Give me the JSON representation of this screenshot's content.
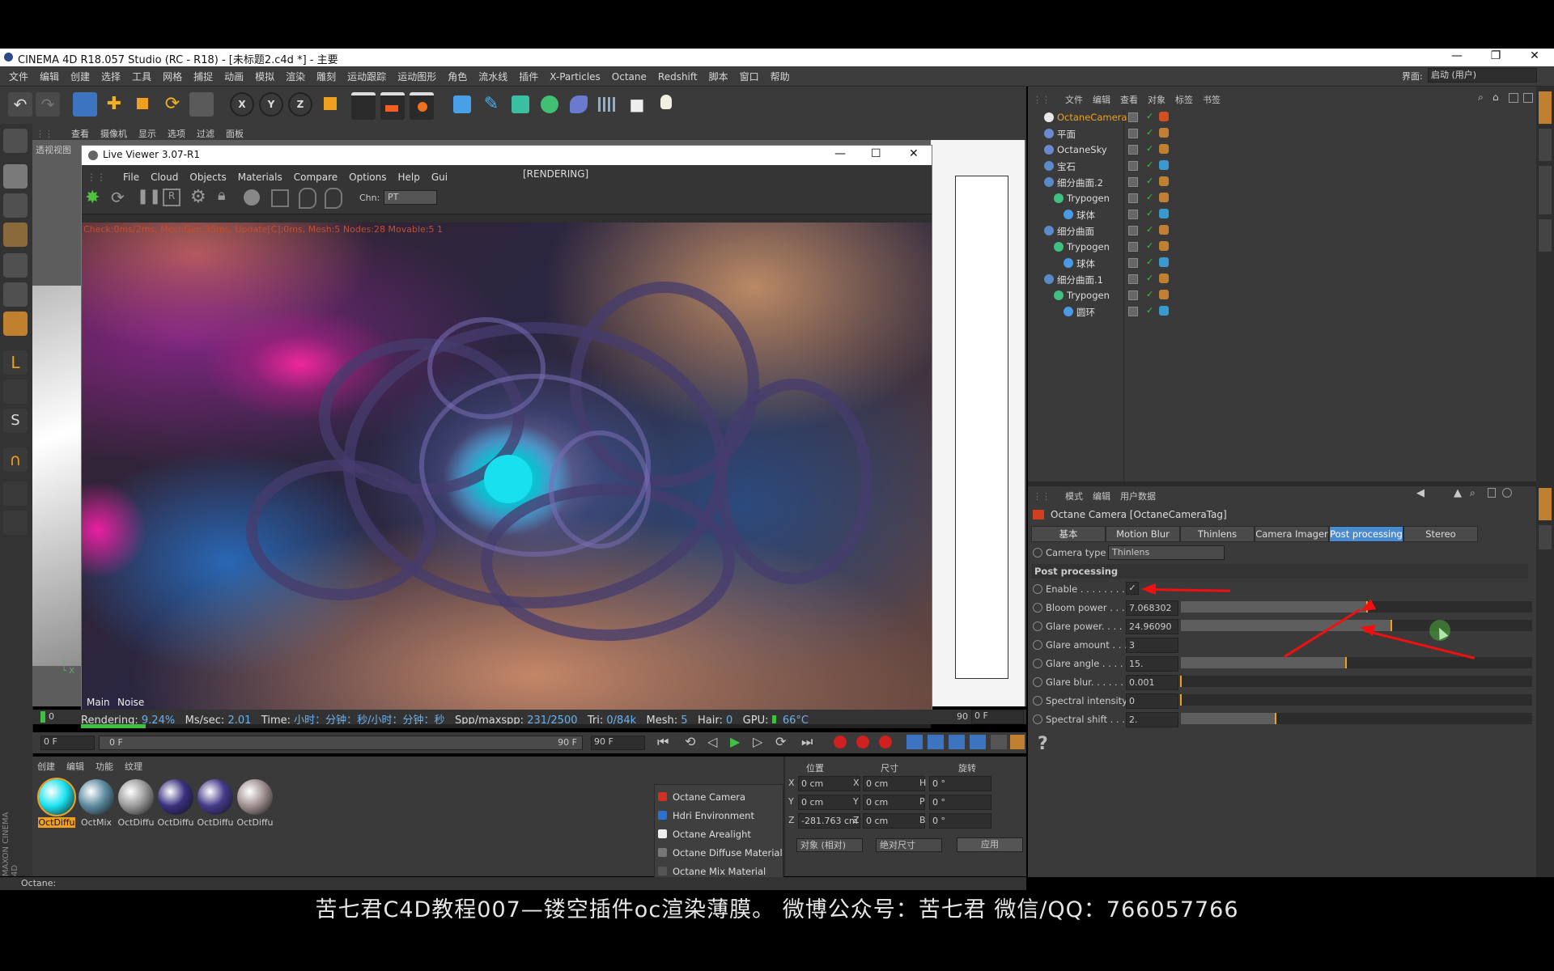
{
  "window": {
    "title": "CINEMA 4D R18.057 Studio (RC - R18) - [未标题2.c4d *] - 主要",
    "minimize": "—",
    "maximize": "❐",
    "close": "✕"
  },
  "menubar": [
    "文件",
    "编辑",
    "创建",
    "选择",
    "工具",
    "网格",
    "捕捉",
    "动画",
    "模拟",
    "渲染",
    "雕刻",
    "运动跟踪",
    "运动图形",
    "角色",
    "流水线",
    "插件",
    "X-Particles",
    "Octane",
    "Redshift",
    "脚本",
    "窗口",
    "帮助"
  ],
  "layout": {
    "label": "界面:",
    "value": "启动 (用户)"
  },
  "viewport_menu": [
    "查看",
    "摄像机",
    "显示",
    "选项",
    "过滤",
    "面板"
  ],
  "viewport_label": "透视视图",
  "live_viewer": {
    "title": "Live Viewer 3.07-R1",
    "menu": [
      "File",
      "Cloud",
      "Objects",
      "Materials",
      "Compare",
      "Options",
      "Help",
      "Gui"
    ],
    "state": "[RENDERING]",
    "chn_label": "Chn:",
    "chn_value": "PT",
    "overlay": "Check:0ms/2ms, MeshGen:35ms, Update[C]:0ms, Mesh:5 Nodes:28 Movable:5 1",
    "tabs": [
      "Main",
      "Noise"
    ],
    "progress": 0.0924
  },
  "status_line": {
    "rendering_label": "Rendering:",
    "rendering": "9.24%",
    "mssec_label": "Ms/sec:",
    "mssec": "2.01",
    "time_label": "Time:",
    "time": "小时：分钟：秒/小时：分钟：秒",
    "spp_label": "Spp/maxspp:",
    "spp": "231/2500",
    "tri_label": "Tri:",
    "tri": "0/84k",
    "mesh_label": "Mesh:",
    "mesh": "5",
    "hair_label": "Hair:",
    "hair": "0",
    "gpu_label": "GPU:",
    "gpu_temp": "66°C"
  },
  "timeline": {
    "start": "0",
    "frame_left": "0 F",
    "range_start": "0 F",
    "range_end": "90 F",
    "end_field": "90 F",
    "ruler_end": "90",
    "current": "0 F"
  },
  "material_panel": {
    "menu": [
      "创建",
      "编辑",
      "功能",
      "纹理"
    ],
    "materials": [
      {
        "name": "OctDiffu",
        "color": "#1ae3f0"
      },
      {
        "name": "OctMix",
        "color": "#5c8aa0"
      },
      {
        "name": "OctDiffu",
        "color": "#9a9a9a"
      },
      {
        "name": "OctDiffu",
        "color": "#3a3080"
      },
      {
        "name": "OctDiffu",
        "color": "#453a8a"
      },
      {
        "name": "OctDiffu",
        "color": "#a09090"
      }
    ]
  },
  "context_menu": [
    "Octane Camera",
    "Hdri Environment",
    "Octane Arealight",
    "Octane Diffuse Material",
    "Octane Mix Material"
  ],
  "coords": {
    "headers": [
      "位置",
      "尺寸",
      "旋转"
    ],
    "rows": [
      {
        "a": "X",
        "pos": "0 cm",
        "b": "X",
        "size": "0 cm",
        "c": "H",
        "rot": "0 °"
      },
      {
        "a": "Y",
        "pos": "0 cm",
        "b": "Y",
        "size": "0 cm",
        "c": "P",
        "rot": "0 °"
      },
      {
        "a": "Z",
        "pos": "-281.763 cm",
        "b": "Z",
        "size": "0 cm",
        "c": "B",
        "rot": "0 °"
      }
    ],
    "mode1": "对象 (相对)",
    "mode2": "绝对尺寸",
    "apply": "应用"
  },
  "status_bar": "Octane:",
  "object_manager": {
    "menu": [
      "文件",
      "编辑",
      "查看",
      "对象",
      "标签",
      "书签"
    ],
    "objects": [
      {
        "name": "OctaneCamera",
        "indent": 0,
        "active": true
      },
      {
        "name": "平面",
        "indent": 0
      },
      {
        "name": "OctaneSky",
        "indent": 0
      },
      {
        "name": "宝石",
        "indent": 0
      },
      {
        "name": "细分曲面.2",
        "indent": 0
      },
      {
        "name": "Trypogen",
        "indent": 1
      },
      {
        "name": "球体",
        "indent": 2
      },
      {
        "name": "细分曲面",
        "indent": 0
      },
      {
        "name": "Trypogen",
        "indent": 1
      },
      {
        "name": "球体",
        "indent": 2
      },
      {
        "name": "细分曲面.1",
        "indent": 0
      },
      {
        "name": "Trypogen",
        "indent": 1
      },
      {
        "name": "圆环",
        "indent": 2
      }
    ]
  },
  "attributes": {
    "menu": [
      "模式",
      "编辑",
      "用户数据"
    ],
    "title": "Octane Camera [OctaneCameraTag]",
    "tabs": [
      "基本",
      "Motion Blur",
      "Thinlens",
      "Camera Imager",
      "Post processing",
      "Stereo"
    ],
    "active_tab": "Post processing",
    "camera_type_label": "Camera type",
    "camera_type": "Thinlens",
    "section": "Post processing",
    "params": [
      {
        "label": "Enable . . . . . . . . .",
        "value": "✓",
        "type": "check"
      },
      {
        "label": "Bloom power . . .",
        "value": "7.068302",
        "level": 0.53
      },
      {
        "label": "Glare power. . . . .",
        "value": "24.96090",
        "level": 0.6
      },
      {
        "label": "Glare amount . . .",
        "value": "3",
        "type": "none"
      },
      {
        "label": "Glare angle . . . . .",
        "value": "15.",
        "level": 0.47
      },
      {
        "label": "Glare blur. . . . . . .",
        "value": "0.001",
        "level": 0.0
      },
      {
        "label": "Spectral intensity",
        "value": "0",
        "level": 0.0
      },
      {
        "label": "Spectral shift . . . .",
        "value": "2.",
        "level": 0.27
      }
    ],
    "help": "?"
  },
  "subtitle": "苦七君C4D教程007—镂空插件oc渲染薄膜。   微博公众号：苦七君   微信/QQ：766057766",
  "brand": "MAXON CINEMA 4D",
  "colors": {
    "accent": "#4a8ad0",
    "highlight": "#f0a020",
    "arrow": "#f01010"
  }
}
